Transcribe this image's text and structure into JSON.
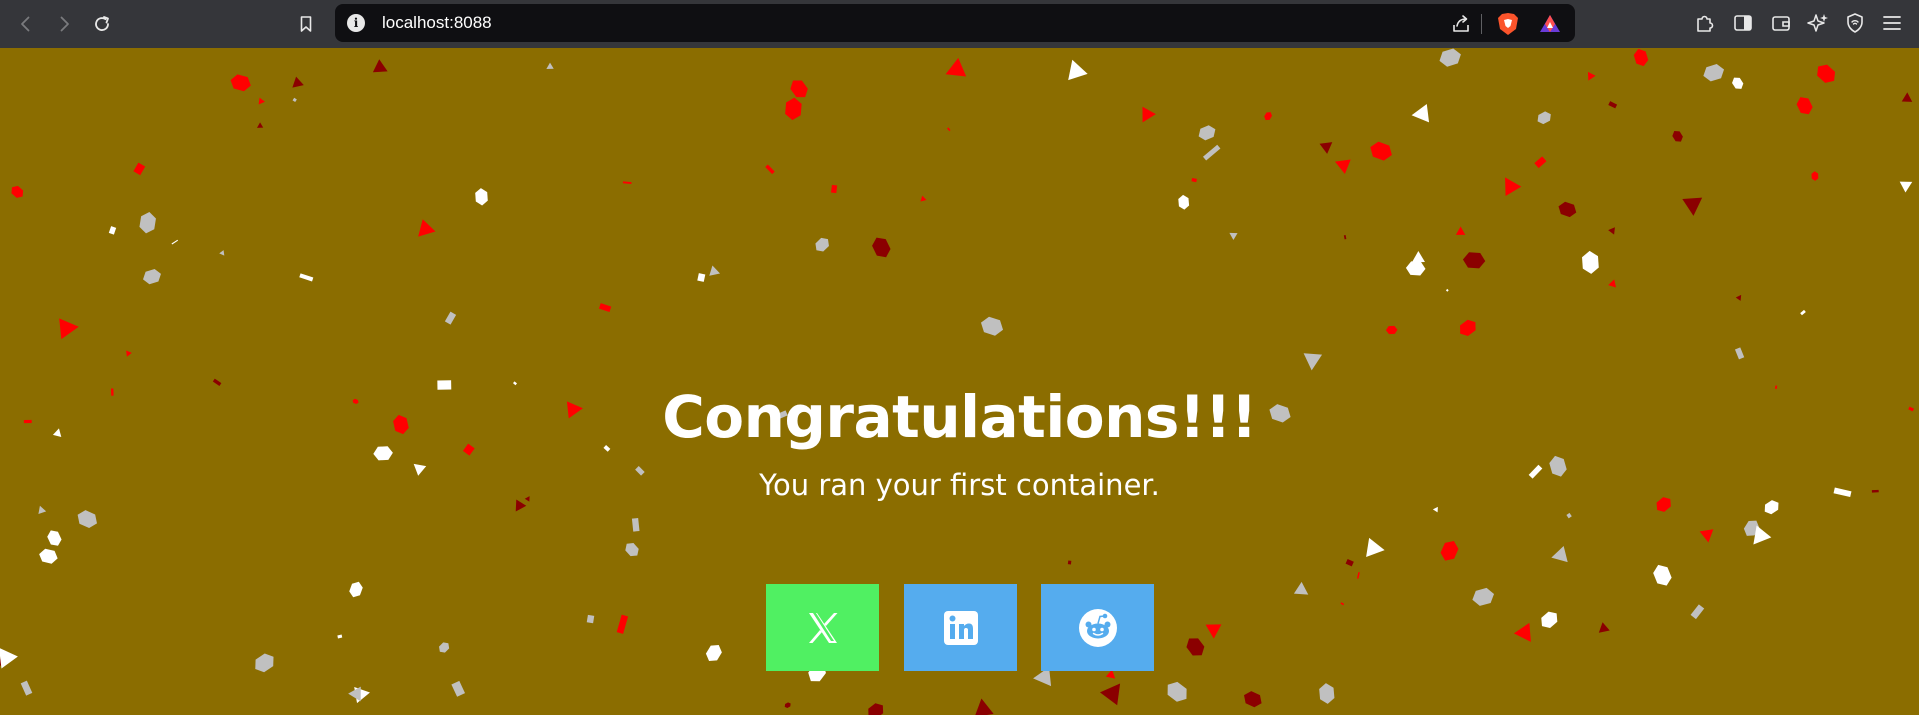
{
  "browser": {
    "url": "localhost:8088",
    "icons": {
      "back": "arrow-left-icon",
      "forward": "arrow-right-icon",
      "reload": "reload-icon",
      "bookmark": "bookmark-icon",
      "site_info": "info-icon",
      "share": "share-icon",
      "shields": "brave-shields-icon",
      "rewards": "brave-rewards-icon",
      "extensions": "puzzle-icon",
      "sidebar": "sidebar-icon",
      "wallet": "wallet-icon",
      "leo": "sparkle-icon",
      "vpn": "vpn-shield-icon",
      "menu": "hamburger-menu-icon"
    },
    "colors": {
      "chrome": "#35363a",
      "urlbar": "#0f0f12"
    }
  },
  "page": {
    "title": "Congratulations!!!",
    "subtitle": "You ran your first container.",
    "background": "#8b6d00",
    "share_buttons": [
      {
        "name": "x",
        "icon": "x-logo-icon",
        "color": "#50f062"
      },
      {
        "name": "linkedin",
        "icon": "linkedin-logo-icon",
        "color": "#55acee"
      },
      {
        "name": "reddit",
        "icon": "reddit-logo-icon",
        "color": "#55acee"
      }
    ],
    "confetti_colors": [
      "#ff0000",
      "#8b0000",
      "#ffffff",
      "#c0c0c0"
    ]
  }
}
